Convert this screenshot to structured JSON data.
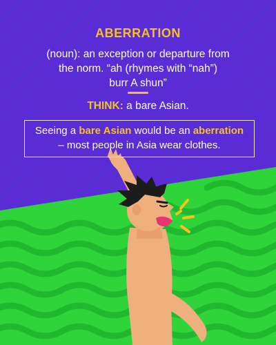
{
  "colors": {
    "background_purple": "#5b2bd6",
    "accent_yellow": "#f7c21b",
    "ground_green": "#2fd43b",
    "wave_green": "#1fb82e",
    "skin": "#f0b07e",
    "hair": "#1c1c1c",
    "mouth": "#e6356f"
  },
  "card": {
    "title": "ABERRATION",
    "definition_lines": [
      "(noun): an exception or departure from",
      "the norm. “ah (rhymes with “nah”)",
      "burr A shun”"
    ],
    "think_label": "THINK:",
    "think_text": " a bare Asian.",
    "example": {
      "prefix": "Seeing a ",
      "highlight_1": "bare Asian",
      "middle": " would be an ",
      "highlight_2": "aberration",
      "suffix": "– most people in Asia wear clothes."
    }
  },
  "illustration": {
    "subject": "shirtless man shouting with raised arm",
    "icons": [
      "shout-lines-icon"
    ]
  }
}
